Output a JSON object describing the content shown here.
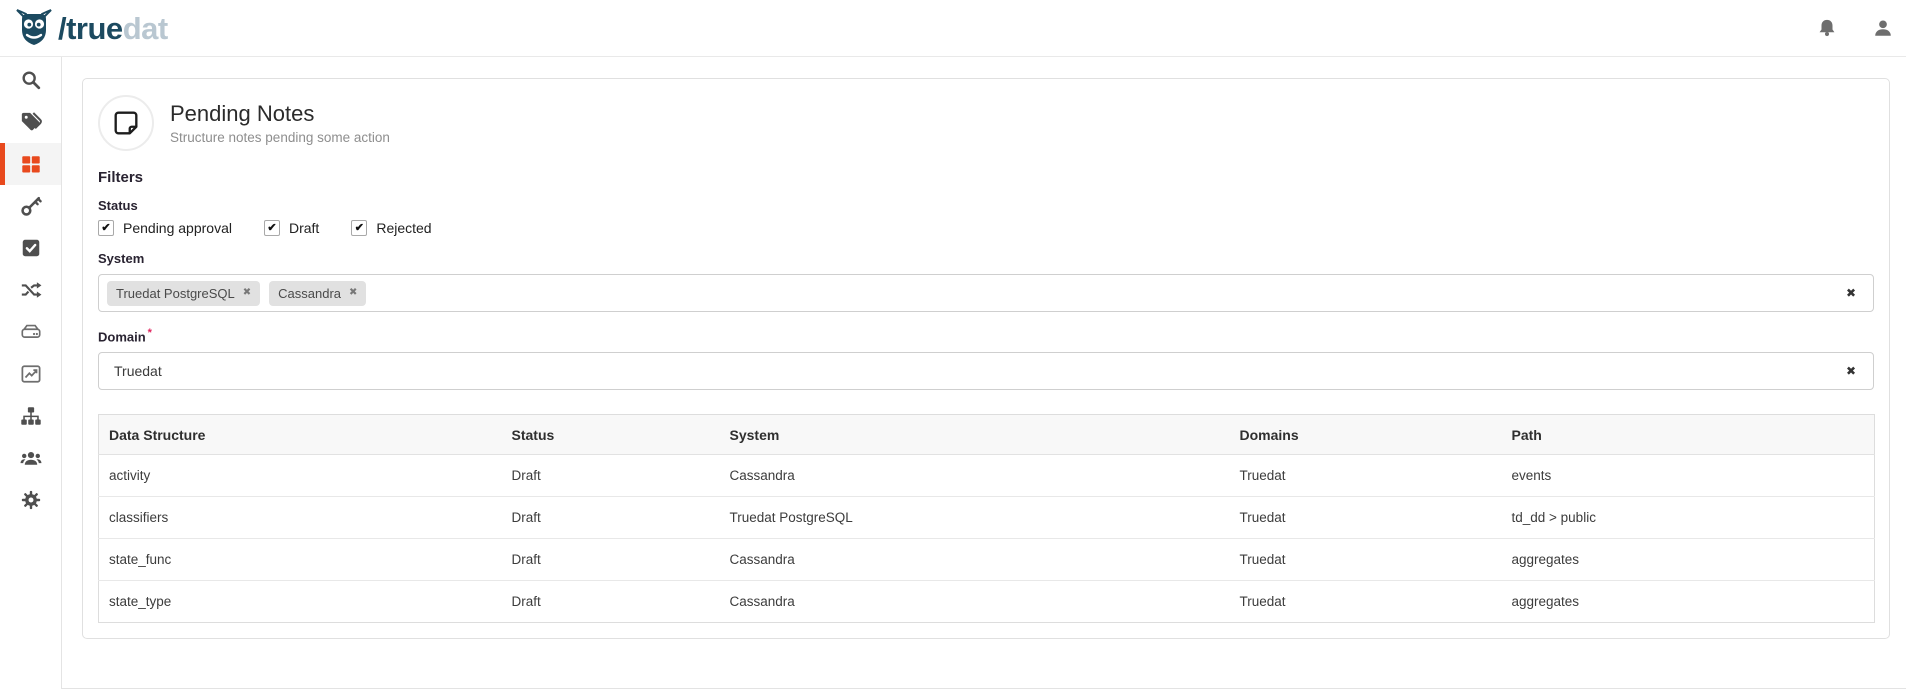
{
  "colors": {
    "accent": "#e8491d",
    "brand_dark": "#1c4a60",
    "brand_light": "#b9c7d1"
  },
  "header": {
    "brand_dark_text": "/true",
    "brand_light_text": "dat"
  },
  "sidebar": {
    "items": [
      {
        "icon": "search",
        "active": false
      },
      {
        "icon": "tags",
        "active": false
      },
      {
        "icon": "grid",
        "active": true
      },
      {
        "icon": "key",
        "active": false
      },
      {
        "icon": "check-square",
        "active": false
      },
      {
        "icon": "shuffle",
        "active": false
      },
      {
        "icon": "hard-drive",
        "active": false
      },
      {
        "icon": "line-chart",
        "active": false
      },
      {
        "icon": "sitemap",
        "active": false
      },
      {
        "icon": "users",
        "active": false
      },
      {
        "icon": "gear",
        "active": false
      }
    ]
  },
  "page": {
    "title": "Pending Notes",
    "subtitle": "Structure notes pending some action",
    "icon": "note"
  },
  "filters": {
    "heading": "Filters",
    "status": {
      "label": "Status",
      "options": [
        {
          "label": "Pending approval",
          "checked": true
        },
        {
          "label": "Draft",
          "checked": true
        },
        {
          "label": "Rejected",
          "checked": true
        }
      ]
    },
    "system": {
      "label": "System",
      "chips": [
        "Truedat PostgreSQL",
        "Cassandra"
      ]
    },
    "domain": {
      "label": "Domain",
      "required_marker": "*",
      "value": "Truedat"
    }
  },
  "ui": {
    "remove_icon": "✖",
    "clear_icon": "✖",
    "check_glyph": "✔"
  },
  "table": {
    "columns": [
      "Data Structure",
      "Status",
      "System",
      "Domains",
      "Path"
    ],
    "rows": [
      {
        "data_structure": "activity",
        "status": "Draft",
        "system": "Cassandra",
        "domains": "Truedat",
        "path": "events"
      },
      {
        "data_structure": "classifiers",
        "status": "Draft",
        "system": "Truedat PostgreSQL",
        "domains": "Truedat",
        "path": "td_dd > public"
      },
      {
        "data_structure": "state_func",
        "status": "Draft",
        "system": "Cassandra",
        "domains": "Truedat",
        "path": "aggregates"
      },
      {
        "data_structure": "state_type",
        "status": "Draft",
        "system": "Cassandra",
        "domains": "Truedat",
        "path": "aggregates"
      }
    ]
  }
}
